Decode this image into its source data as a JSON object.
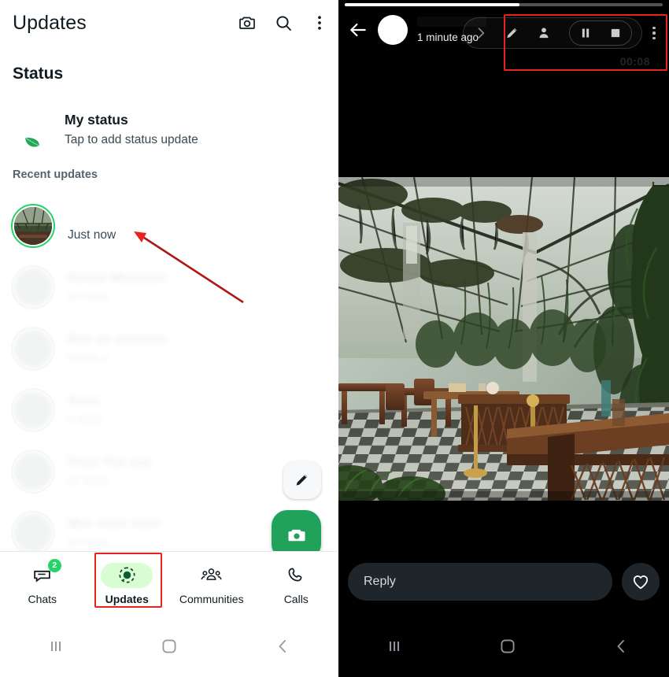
{
  "left": {
    "header": {
      "title": "Updates",
      "icons": [
        "camera-icon",
        "search-icon",
        "overflow-menu-icon"
      ]
    },
    "status_section": {
      "heading": "Status",
      "my_status": {
        "name": "My status",
        "subtitle": "Tap to add status update"
      },
      "recent_label": "Recent updates",
      "rows": [
        {
          "name": "",
          "time": "Just now",
          "redacted": false,
          "name_hidden": true
        },
        {
          "name": "",
          "time": "",
          "redacted": true,
          "name_hidden": true
        },
        {
          "name": "",
          "time": "",
          "redacted": true,
          "name_hidden": true
        },
        {
          "name": "",
          "time": "",
          "redacted": true,
          "name_hidden": true
        },
        {
          "name": "",
          "time": "",
          "redacted": true,
          "name_hidden": true
        },
        {
          "name": "",
          "time": "",
          "redacted": true,
          "name_hidden": true
        }
      ]
    },
    "fabs": {
      "edit_label": "edit-fab",
      "camera_label": "camera-fab"
    },
    "bottom_nav": {
      "items": [
        {
          "label": "Chats",
          "icon": "chats-icon",
          "badge": "2",
          "active": false
        },
        {
          "label": "Updates",
          "icon": "updates-icon",
          "badge": "",
          "active": true
        },
        {
          "label": "Communities",
          "icon": "communities-icon",
          "badge": "",
          "active": false
        },
        {
          "label": "Calls",
          "icon": "calls-icon",
          "badge": "",
          "active": false
        }
      ]
    },
    "highlight_color": "#e8231f",
    "accent_green": "#25d366",
    "active_pill_green": "#d9fdd3"
  },
  "right": {
    "progress_percent": 55,
    "header": {
      "back": "back-arrow-icon",
      "timestamp": "1 minute ago"
    },
    "control_pill": {
      "icons": [
        "chevron-right-icon",
        "pencil-icon",
        "person-icon",
        "pause-icon",
        "stop-icon"
      ],
      "overflow": "overflow-menu-icon"
    },
    "recording_timer": "00:08",
    "media": {
      "description": "greenhouse-conservatory-interior"
    },
    "reply": {
      "placeholder": "Reply",
      "like_icon": "heart-icon"
    },
    "background": "#000000",
    "highlight_color": "#e8231f"
  },
  "system_nav": {
    "recents": "recents-icon",
    "home": "home-icon",
    "back": "back-icon"
  }
}
